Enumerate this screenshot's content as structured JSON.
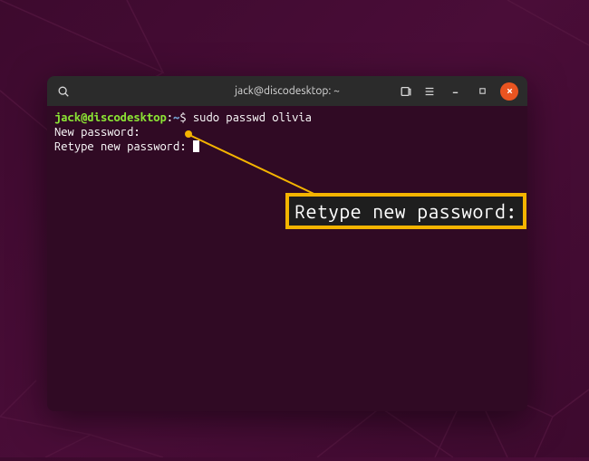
{
  "window": {
    "title": "jack@discodesktop: ~"
  },
  "terminal": {
    "prompt_user_host": "jack@discodesktop",
    "prompt_separator": ":",
    "prompt_path": "~",
    "prompt_symbol": "$",
    "command": " sudo passwd olivia",
    "line2": "New password:",
    "line3": "Retype new password: "
  },
  "callout": {
    "text": "Retype new password:"
  }
}
